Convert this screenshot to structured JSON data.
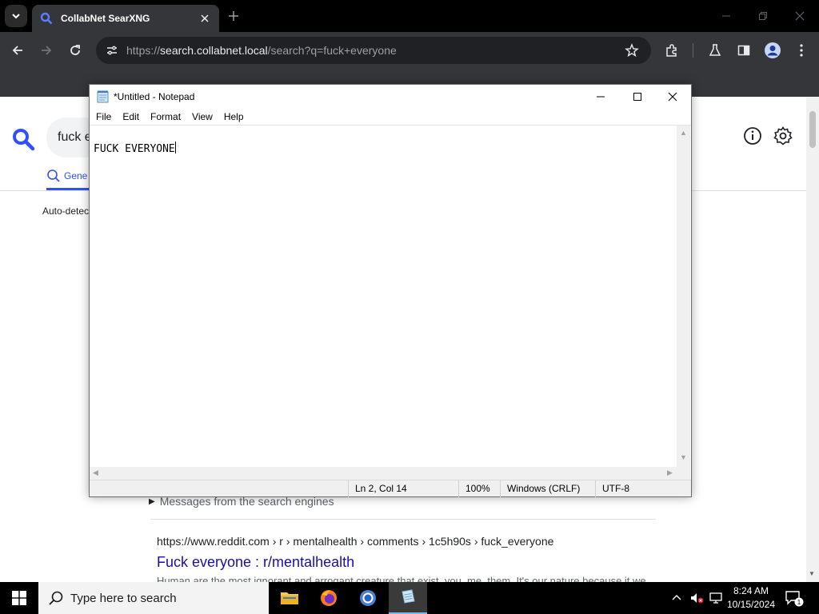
{
  "browser": {
    "tab_title": "CollabNet SearXNG",
    "url_prefix": "https://",
    "url_host": "search.collabnet.local",
    "url_path": "/search?q=fuck+everyone"
  },
  "page": {
    "search_value": "fuck e",
    "tab_label": "Gene",
    "autodetect_text": "Auto-detec",
    "messages_label": "Messages from the search engines",
    "result": {
      "url": "https://www.reddit.com  › r › mentalhealth › comments › 1c5h90s › fuck_everyone",
      "title": "Fuck everyone : r/mentalhealth",
      "snippet": "Human are the most ignorant and arrogant creature that exist, you, me, them. It's our nature because it we"
    }
  },
  "notepad": {
    "title": "*Untitled - Notepad",
    "menu": [
      "File",
      "Edit",
      "Format",
      "View",
      "Help"
    ],
    "content": "FUCK EVERYONE",
    "status": {
      "position": "Ln 2, Col 14",
      "zoom": "100%",
      "line_endings": "Windows (CRLF)",
      "encoding": "UTF-8"
    }
  },
  "taskbar": {
    "search_placeholder": "Type here to search",
    "time": "8:24 AM",
    "date": "10/15/2024",
    "notification_count": "1"
  },
  "colors": {
    "accent": "#3050ff",
    "link": "#1a0dab",
    "chrome_dark": "#35363a"
  }
}
